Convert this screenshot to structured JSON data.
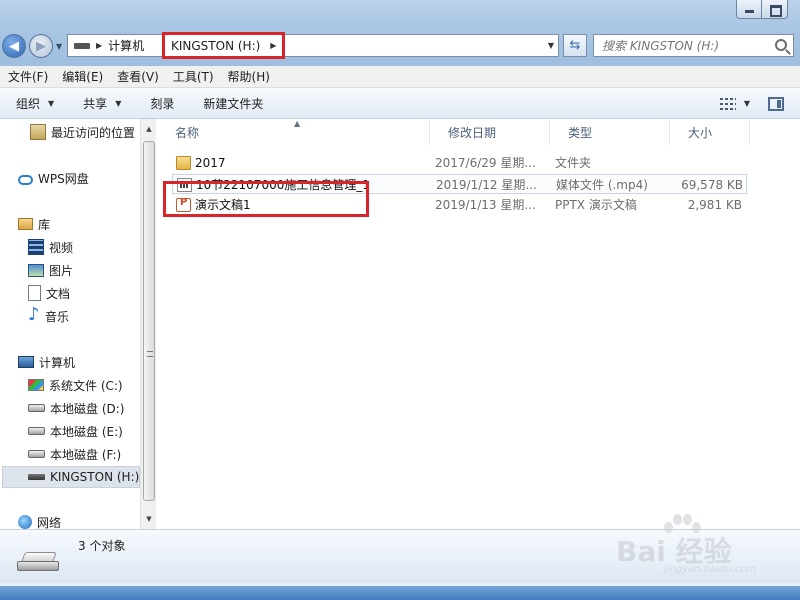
{
  "search": {
    "placeholder": "搜索 KINGSTON (H:)"
  },
  "address": {
    "crumbs": [
      "计算机"
    ],
    "current": "KINGSTON (H:)"
  },
  "menu": [
    "文件(F)",
    "编辑(E)",
    "查看(V)",
    "工具(T)",
    "帮助(H)"
  ],
  "commands": {
    "organize": "组织",
    "share": "共享",
    "burn": "刻录",
    "new_folder": "新建文件夹"
  },
  "nav": {
    "recent": "最近访问的位置",
    "wps": "WPS网盘",
    "libraries": "库",
    "videos": "视频",
    "pictures": "图片",
    "documents": "文档",
    "music": "音乐",
    "computer": "计算机",
    "drive_c": "系统文件 (C:)",
    "drive_d": "本地磁盘 (D:)",
    "drive_e": "本地磁盘 (E:)",
    "drive_f": "本地磁盘 (F:)",
    "drive_h": "KINGSTON (H:)",
    "network": "网络"
  },
  "columns": {
    "name": "名称",
    "date": "修改日期",
    "type": "类型",
    "size": "大小"
  },
  "files": [
    {
      "name": "2017",
      "date": "2017/6/29 星期...",
      "type": "文件夹",
      "size": "",
      "icon": "folder-icon"
    },
    {
      "name": "10节22107000施工信息管理_1",
      "date": "2019/1/12 星期...",
      "type": "媒体文件 (.mp4)",
      "size": "69,578 KB",
      "icon": "video-file-icon"
    },
    {
      "name": "演示文稿1",
      "date": "2019/1/13 星期...",
      "type": "PPTX 演示文稿",
      "size": "2,981 KB",
      "icon": "pptx-file-icon"
    }
  ],
  "status": {
    "count": "3 个对象"
  },
  "watermark": {
    "text": "Bai 经验",
    "url": "jingyan.baidu.com"
  },
  "colors": {
    "highlight": "#d8252a",
    "accent": "#2e65b3"
  }
}
